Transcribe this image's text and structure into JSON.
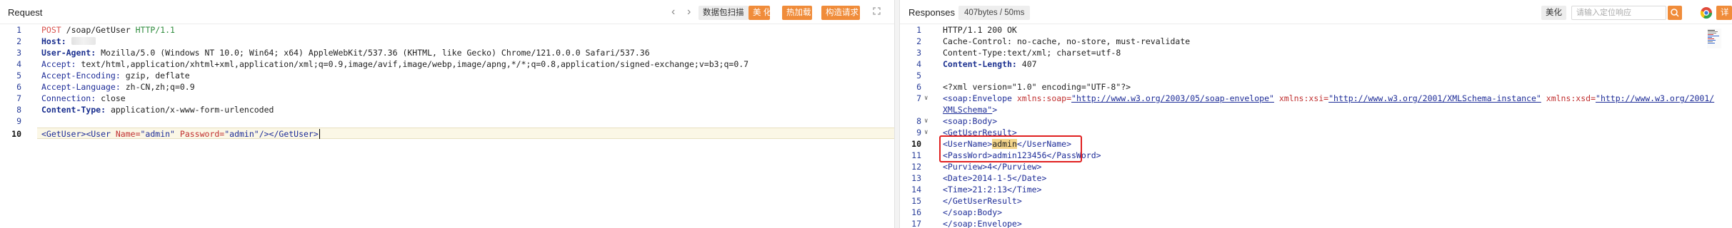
{
  "request": {
    "title": "Request",
    "toolbar": {
      "scan_label": "数据包扫描",
      "beautify_label": "美 化",
      "hot_load_label": "热加载",
      "construct_label": "构造请求"
    },
    "lines": [
      {
        "n": "1"
      },
      {
        "n": "2"
      },
      {
        "n": "3"
      },
      {
        "n": "4"
      },
      {
        "n": "5"
      },
      {
        "n": "6"
      },
      {
        "n": "7"
      },
      {
        "n": "8"
      },
      {
        "n": "9"
      },
      {
        "n": "10"
      }
    ],
    "raw": {
      "method": "POST",
      "path": "/soap/GetUser",
      "version": "HTTP/1.1",
      "host_key": "Host:",
      "ua_key": "User-Agent:",
      "ua_val": "Mozilla/5.0 (Windows NT 10.0; Win64; x64) AppleWebKit/537.36 (KHTML, like Gecko) Chrome/121.0.0.0 Safari/537.36",
      "accept_key": "Accept:",
      "accept_val": "text/html,application/xhtml+xml,application/xml;q=0.9,image/avif,image/webp,image/apng,*/*;q=0.8,application/signed-exchange;v=b3;q=0.7",
      "enc_key": "Accept-Encoding:",
      "enc_val": "gzip, deflate",
      "lang_key": "Accept-Language:",
      "lang_val": "zh-CN,zh;q=0.9",
      "conn_key": "Connection:",
      "conn_val": "close",
      "ct_key": "Content-Type:",
      "ct_val": "application/x-www-form-urlencoded",
      "b_open": "<GetUser>",
      "b_user_tag": "<User",
      "b_name_attr": "Name=",
      "b_name_val": "\"admin\"",
      "b_pwd_attr": "Password=",
      "b_pwd_val": "\"admin\"",
      "b_selfclose": "/>",
      "b_close": "</GetUser>"
    }
  },
  "response": {
    "title": "Responses",
    "size_badge": "407bytes / 50ms",
    "beautify_label": "美化",
    "search_placeholder": "请输入定位响应",
    "edit_label": "详",
    "lines": [
      {
        "n": "1"
      },
      {
        "n": "2"
      },
      {
        "n": "3"
      },
      {
        "n": "4"
      },
      {
        "n": "5"
      },
      {
        "n": "6"
      },
      {
        "n": "7"
      },
      {
        "n": "8"
      },
      {
        "n": "9"
      },
      {
        "n": "10"
      },
      {
        "n": "11"
      },
      {
        "n": "12"
      },
      {
        "n": "13"
      },
      {
        "n": "14"
      },
      {
        "n": "15"
      },
      {
        "n": "16"
      },
      {
        "n": "17"
      }
    ],
    "raw": {
      "status": "HTTP/1.1 200 OK",
      "cache": "Cache-Control: no-cache, no-store, must-revalidate",
      "ctype": "Content-Type:text/xml; charset=utf-8",
      "clen_key": "Content-Length:",
      "clen_val": "407",
      "xmldecl": "<?xml version=\"1.0\" encoding=\"UTF-8\"?>",
      "env_open": "<soap:Envelope",
      "env_attr1": "xmlns:soap=",
      "env_url1": "\"http://www.w3.org/2003/05/soap-envelope\"",
      "env_attr2": "xmlns:xsi=",
      "env_url2": "\"http://www.w3.org/2001/XMLSchema-instance\"",
      "env_attr3": "xmlns:xsd=",
      "env_url3a": "\"http://www.w3.org/2001/",
      "env_url3b": "XMLSchema\"",
      "env_gt": ">",
      "body_open": "<soap:Body>",
      "result_open": "<GetUserResult>",
      "un_open": "<UserName>",
      "un_val": "admin",
      "un_close": "</UserName>",
      "pw_line": "<PassWord>admin123456</PassWord>",
      "purview": "<Purview>4</Purview>",
      "date": "<Date>2014-1-5</Date>",
      "time": "<Time>21:2:13</Time>",
      "result_close": "</GetUserResult>",
      "body_close": "</soap:Body>",
      "env_close": "</soap:Envelope>"
    }
  },
  "icons": {
    "nav_prev": "‹",
    "nav_next": "›",
    "fold": "∨"
  },
  "colors": {
    "accent": "#f08c3a",
    "highlight_box": "#e02020"
  }
}
